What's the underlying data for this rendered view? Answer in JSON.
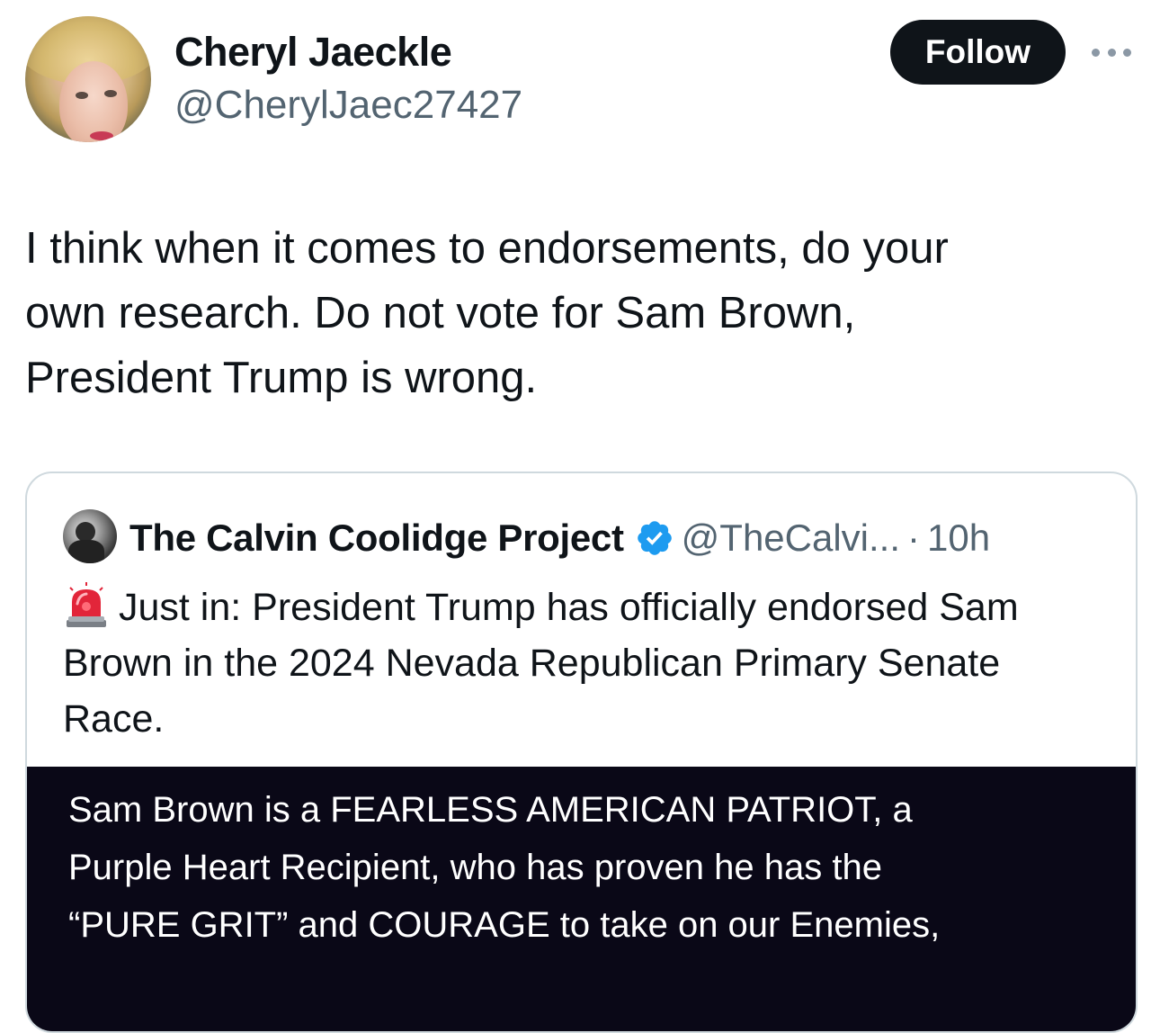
{
  "author": {
    "name": "Cheryl Jaeckle",
    "handle": "@CherylJaec27427",
    "follow_label": "Follow"
  },
  "tweet": {
    "text": "I think when it comes to endorsements, do your\nown research. Do not vote for Sam Brown,\nPresident Trump is wrong."
  },
  "quoted_tweet": {
    "author_name": "The Calvin Coolidge Project",
    "handle": "@TheCalvi...",
    "separator": "·",
    "time": "10h",
    "text": "Just in: President Trump has officially endorsed Sam Brown in the 2024 Nevada Republican Primary Senate Race.",
    "image_text": "Sam Brown is a FEARLESS AMERICAN PATRIOT, a\nPurple Heart Recipient, who has proven he has the\n“PURE GRIT” and COURAGE to take on our Enemies,",
    "verified_color": "#1d9bf0"
  },
  "icons": {
    "more": "more-horizontal-icon",
    "verified": "verified-badge-icon",
    "siren": "siren-emoji-icon"
  }
}
